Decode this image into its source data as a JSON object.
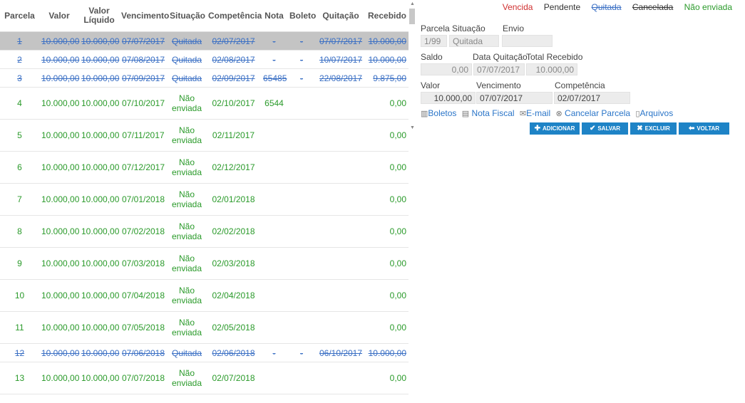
{
  "grid": {
    "headers": {
      "parcela": "Parcela",
      "valor": "Valor",
      "liquido": "Valor Líquido",
      "vencimento": "Vencimento",
      "situacao": "Situação",
      "competencia": "Competência",
      "nota": "Nota",
      "boleto": "Boleto",
      "quitacao": "Quitação",
      "recebido": "Recebido"
    },
    "rows": [
      {
        "parcela": "1",
        "valor": "10.000,00",
        "liquido": "10.000,00",
        "vencimento": "07/07/2017",
        "situacao": "Quitada",
        "competencia": "02/07/2017",
        "nota": "-",
        "boleto": "-",
        "quitacao": "07/07/2017",
        "recebido": "10.000,00",
        "status": "paid",
        "selected": true
      },
      {
        "parcela": "2",
        "valor": "10.000,00",
        "liquido": "10.000,00",
        "vencimento": "07/08/2017",
        "situacao": "Quitada",
        "competencia": "02/08/2017",
        "nota": "-",
        "boleto": "-",
        "quitacao": "10/07/2017",
        "recebido": "10.000,00",
        "status": "paid"
      },
      {
        "parcela": "3",
        "valor": "10.000,00",
        "liquido": "10.000,00",
        "vencimento": "07/09/2017",
        "situacao": "Quitada",
        "competencia": "02/09/2017",
        "nota": "65485",
        "boleto": "-",
        "quitacao": "22/08/2017",
        "recebido": "9.875,00",
        "status": "paid"
      },
      {
        "parcela": "4",
        "valor": "10.000,00",
        "liquido": "10.000,00",
        "vencimento": "07/10/2017",
        "situacao": "Não enviada",
        "competencia": "02/10/2017",
        "nota": "6544",
        "boleto": "",
        "quitacao": "",
        "recebido": "0,00",
        "status": "open"
      },
      {
        "parcela": "5",
        "valor": "10.000,00",
        "liquido": "10.000,00",
        "vencimento": "07/11/2017",
        "situacao": "Não enviada",
        "competencia": "02/11/2017",
        "nota": "",
        "boleto": "",
        "quitacao": "",
        "recebido": "0,00",
        "status": "open"
      },
      {
        "parcela": "6",
        "valor": "10.000,00",
        "liquido": "10.000,00",
        "vencimento": "07/12/2017",
        "situacao": "Não enviada",
        "competencia": "02/12/2017",
        "nota": "",
        "boleto": "",
        "quitacao": "",
        "recebido": "0,00",
        "status": "open"
      },
      {
        "parcela": "7",
        "valor": "10.000,00",
        "liquido": "10.000,00",
        "vencimento": "07/01/2018",
        "situacao": "Não enviada",
        "competencia": "02/01/2018",
        "nota": "",
        "boleto": "",
        "quitacao": "",
        "recebido": "0,00",
        "status": "open"
      },
      {
        "parcela": "8",
        "valor": "10.000,00",
        "liquido": "10.000,00",
        "vencimento": "07/02/2018",
        "situacao": "Não enviada",
        "competencia": "02/02/2018",
        "nota": "",
        "boleto": "",
        "quitacao": "",
        "recebido": "0,00",
        "status": "open"
      },
      {
        "parcela": "9",
        "valor": "10.000,00",
        "liquido": "10.000,00",
        "vencimento": "07/03/2018",
        "situacao": "Não enviada",
        "competencia": "02/03/2018",
        "nota": "",
        "boleto": "",
        "quitacao": "",
        "recebido": "0,00",
        "status": "open"
      },
      {
        "parcela": "10",
        "valor": "10.000,00",
        "liquido": "10.000,00",
        "vencimento": "07/04/2018",
        "situacao": "Não enviada",
        "competencia": "02/04/2018",
        "nota": "",
        "boleto": "",
        "quitacao": "",
        "recebido": "0,00",
        "status": "open"
      },
      {
        "parcela": "11",
        "valor": "10.000,00",
        "liquido": "10.000,00",
        "vencimento": "07/05/2018",
        "situacao": "Não enviada",
        "competencia": "02/05/2018",
        "nota": "",
        "boleto": "",
        "quitacao": "",
        "recebido": "0,00",
        "status": "open"
      },
      {
        "parcela": "12",
        "valor": "10.000,00",
        "liquido": "10.000,00",
        "vencimento": "07/06/2018",
        "situacao": "Quitada",
        "competencia": "02/06/2018",
        "nota": "-",
        "boleto": "-",
        "quitacao": "06/10/2017",
        "recebido": "10.000,00",
        "status": "paid"
      },
      {
        "parcela": "13",
        "valor": "10.000,00",
        "liquido": "10.000,00",
        "vencimento": "07/07/2018",
        "situacao": "Não enviada",
        "competencia": "02/07/2018",
        "nota": "",
        "boleto": "",
        "quitacao": "",
        "recebido": "0,00",
        "status": "open"
      }
    ]
  },
  "legend": {
    "vencida": "Vencida",
    "pendente": "Pendente",
    "quitada": "Quitada",
    "cancelada": "Cancelada",
    "nao_enviada": "Não enviada"
  },
  "form": {
    "parcela_label": "Parcela",
    "situacao_label": "Situação",
    "envio_label": "Envio",
    "parcela_value": "1/99",
    "situacao_value": "Quitada",
    "envio_value": "",
    "saldo_label": "Saldo",
    "data_quitacao_label": "Data Quitação",
    "total_recebido_label": "Total Recebido",
    "saldo_value": "0,00",
    "data_quitacao_value": "07/07/2017",
    "total_recebido_value": "10.000,00",
    "valor_label": "Valor",
    "vencimento_label": "Vencimento",
    "competencia_label": "Competência",
    "valor_value": "10.000,00",
    "vencimento_value": "07/07/2017",
    "competencia_value": "02/07/2017"
  },
  "links": {
    "boletos": "Boletos",
    "nota_fiscal": "Nota Fiscal",
    "email": "E-mail",
    "cancelar": "Cancelar Parcela",
    "arquivos": "Arquivos"
  },
  "buttons": {
    "adicionar": "ADICIONAR",
    "salvar": "SALVAR",
    "excluir": "EXCLUIR",
    "voltar": "VOLTAR"
  },
  "colors": {
    "paid": "#3a6fc4",
    "open": "#2a9a2a",
    "overdue": "#d03030",
    "button": "#1e83c6",
    "selected_row": "#c4c4c4"
  },
  "icons": {
    "boletos": "barcode-icon",
    "nota_fiscal": "document-icon",
    "email": "envelope-icon",
    "cancelar": "cancel-icon",
    "arquivos": "file-icon",
    "adicionar": "plus-icon",
    "salvar": "check-icon",
    "excluir": "x-icon",
    "voltar": "arrow-left-icon"
  }
}
